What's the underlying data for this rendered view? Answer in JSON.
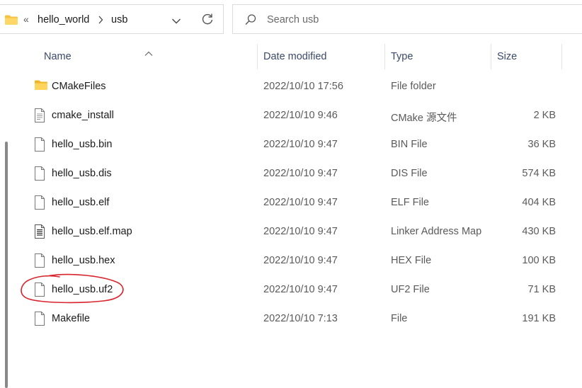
{
  "address_bar": {
    "breadcrumb_overflow": "«",
    "crumbs": [
      "hello_world",
      "usb"
    ],
    "folder_icon": "folder-icon",
    "dropdown_icon": "chevron-down-icon",
    "refresh_icon": "refresh-icon"
  },
  "search": {
    "placeholder": "Search usb",
    "value": "",
    "icon": "search-icon"
  },
  "columns": {
    "name": "Name",
    "date": "Date modified",
    "type": "Type",
    "size": "Size"
  },
  "files": [
    {
      "name": "CMakeFiles",
      "date": "2022/10/10 17:56",
      "type": "File folder",
      "size": "",
      "icon": "folder-icon"
    },
    {
      "name": "cmake_install",
      "date": "2022/10/10 9:46",
      "type": "CMake 源文件",
      "size": "2 KB",
      "icon": "text-file-icon"
    },
    {
      "name": "hello_usb.bin",
      "date": "2022/10/10 9:47",
      "type": "BIN File",
      "size": "36 KB",
      "icon": "file-icon"
    },
    {
      "name": "hello_usb.dis",
      "date": "2022/10/10 9:47",
      "type": "DIS File",
      "size": "574 KB",
      "icon": "file-icon"
    },
    {
      "name": "hello_usb.elf",
      "date": "2022/10/10 9:47",
      "type": "ELF File",
      "size": "404 KB",
      "icon": "file-icon"
    },
    {
      "name": "hello_usb.elf.map",
      "date": "2022/10/10 9:47",
      "type": "Linker Address Map",
      "size": "430 KB",
      "icon": "map-file-icon"
    },
    {
      "name": "hello_usb.hex",
      "date": "2022/10/10 9:47",
      "type": "HEX File",
      "size": "100 KB",
      "icon": "file-icon"
    },
    {
      "name": "hello_usb.uf2",
      "date": "2022/10/10 9:47",
      "type": "UF2 File",
      "size": "71 KB",
      "icon": "file-icon"
    },
    {
      "name": "Makefile",
      "date": "2022/10/10 7:13",
      "type": "File",
      "size": "191 KB",
      "icon": "file-icon"
    }
  ],
  "colors": {
    "annotation": "#d9232d",
    "folder": "#f5c342",
    "header_text": "#3a4a6b"
  }
}
